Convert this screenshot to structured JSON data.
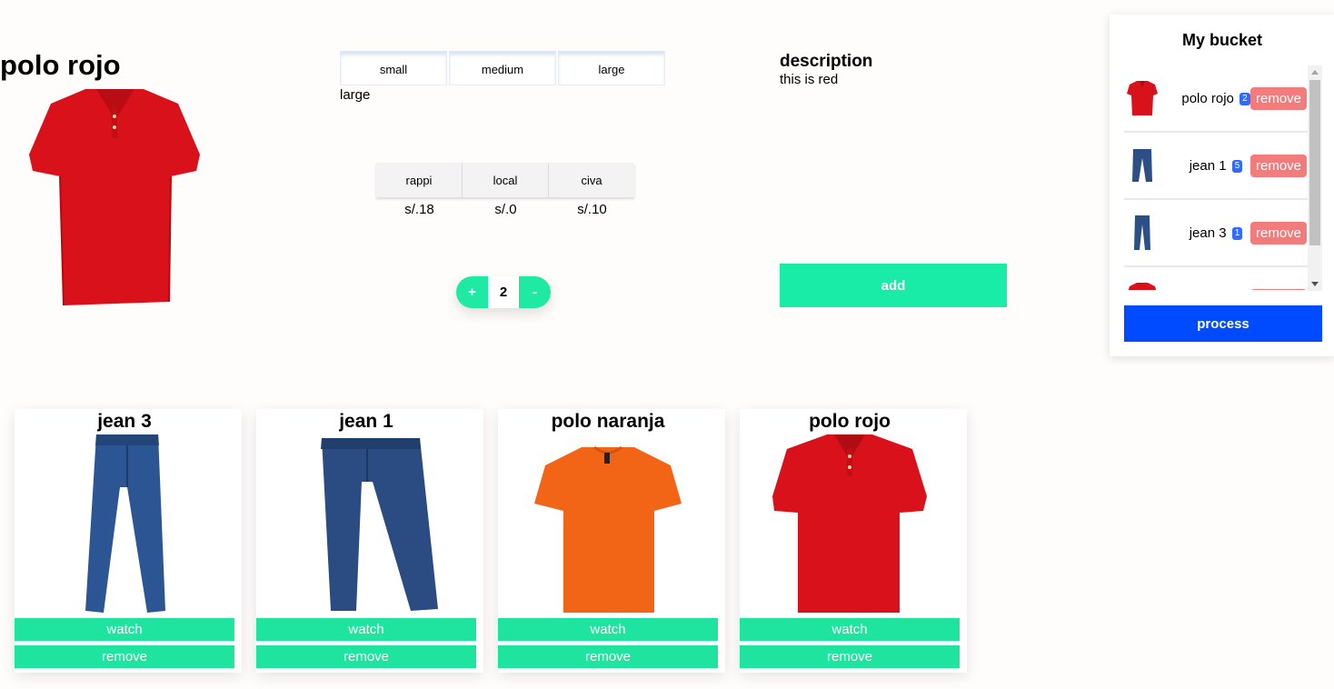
{
  "product": {
    "title": "polo rojo",
    "image_icon": "red-polo-shirt",
    "selected_size": "large",
    "description_title": "description",
    "description_text": "this is red",
    "quantity": "2",
    "plus_label": "+",
    "minus_label": "-",
    "add_label": "add"
  },
  "sizes": [
    "small",
    "medium",
    "large"
  ],
  "stores": [
    {
      "name": "rappi",
      "price": "s/.18"
    },
    {
      "name": "local",
      "price": "s/.0"
    },
    {
      "name": "civa",
      "price": "s/.10"
    }
  ],
  "bucket": {
    "title": "My bucket",
    "items": [
      {
        "name": "polo rojo",
        "count": "2",
        "icon": "red-polo-shirt",
        "remove_label": "remove"
      },
      {
        "name": "jean 1",
        "count": "5",
        "icon": "jeans",
        "remove_label": "remove"
      },
      {
        "name": "jean 3",
        "count": "1",
        "icon": "jeans",
        "remove_label": "remove"
      },
      {
        "name": "",
        "count": "",
        "icon": "red-polo-shirt",
        "remove_label": ""
      }
    ],
    "process_label": "process"
  },
  "cards": [
    {
      "title": "jean 3",
      "icon": "jeans",
      "watch_label": "watch",
      "remove_label": "remove"
    },
    {
      "title": "jean 1",
      "icon": "jeans",
      "watch_label": "watch",
      "remove_label": "remove"
    },
    {
      "title": "polo naranja",
      "icon": "orange-tshirt",
      "watch_label": "watch",
      "remove_label": "remove"
    },
    {
      "title": "polo rojo",
      "icon": "red-polo-shirt",
      "watch_label": "watch",
      "remove_label": "remove"
    }
  ],
  "colors": {
    "accent_green": "#19eca7",
    "process_blue": "#004bff",
    "remove_red": "#f27c7c",
    "badge_blue": "#2f6bff",
    "polo_red": "#d8111a",
    "polo_orange": "#f26516",
    "jeans_blue": "#2c4f86"
  }
}
